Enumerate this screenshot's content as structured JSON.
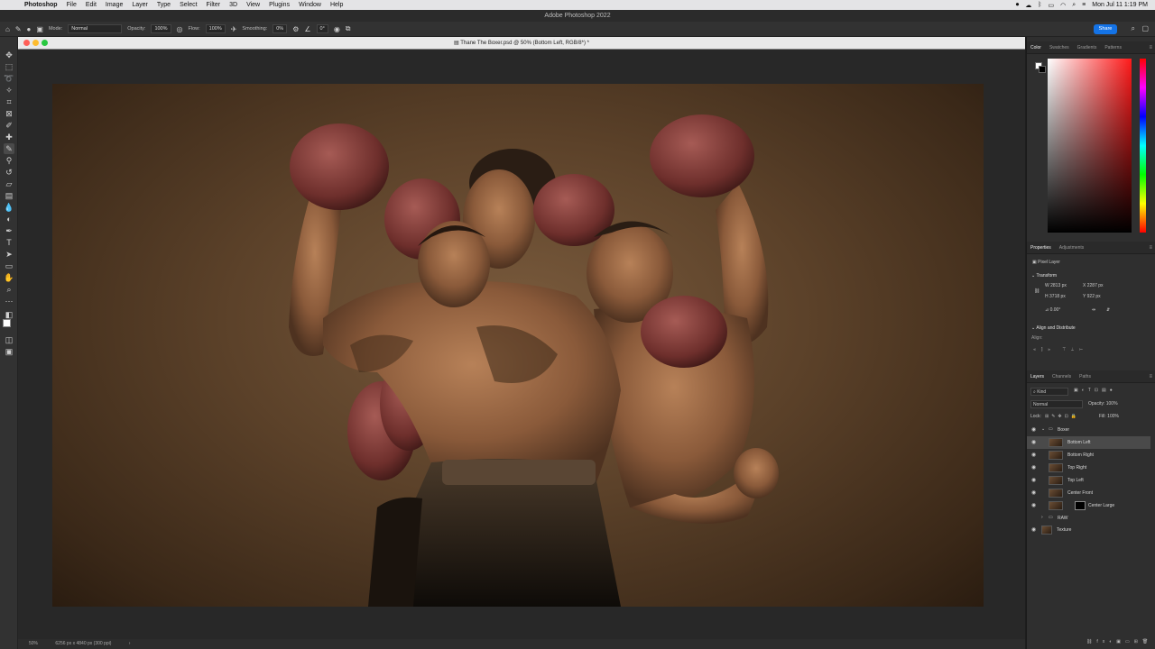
{
  "menubar": {
    "apple": "",
    "items": [
      "Photoshop",
      "File",
      "Edit",
      "Image",
      "Layer",
      "Type",
      "Select",
      "Filter",
      "3D",
      "View",
      "Plugins",
      "Window",
      "Help"
    ],
    "clock": "Mon Jul 11  1:19 PM"
  },
  "window": {
    "title": "Adobe Photoshop 2022"
  },
  "options": {
    "mode_label": "Mode:",
    "mode_value": "Normal",
    "opacity_label": "Opacity:",
    "opacity_value": "100%",
    "flow_label": "Flow:",
    "flow_value": "100%",
    "smoothing_label": "Smoothing:",
    "smoothing_value": "0%",
    "angle_value": "0°",
    "share_label": "Share"
  },
  "document": {
    "tab_title": "Thane The Boxer.psd @ 50% (Bottom Left, RGB/8*) *"
  },
  "statusbar": {
    "zoom": "50%",
    "info": "6256 px x 4840 px (300 ppi)",
    "arrow": "›"
  },
  "color_panel": {
    "tabs": [
      "Color",
      "Swatches",
      "Gradients",
      "Patterns"
    ],
    "hue_color": "#ff1a1a"
  },
  "properties_panel": {
    "tabs": [
      "Properties",
      "Adjustments"
    ],
    "kind": "Pixel Layer",
    "transform_title": "Transform",
    "w_label": "W",
    "w_value": "2813 px",
    "h_label": "H",
    "h_value": "3718 px",
    "x_label": "X",
    "x_value": "2287 px",
    "y_label": "Y",
    "y_value": "922 px",
    "angle_value": "0.00°",
    "align_title": "Align and Distribute",
    "align_label": "Align:"
  },
  "layers_panel": {
    "tabs": [
      "Layers",
      "Channels",
      "Paths"
    ],
    "filter_label": "Kind",
    "blend_mode": "Normal",
    "opacity_label": "Opacity:",
    "opacity_value": "100%",
    "lock_label": "Lock:",
    "fill_label": "Fill:",
    "fill_value": "100%",
    "layers": [
      {
        "name": "Boxer",
        "type": "group",
        "open": true
      },
      {
        "name": "Bottom Left",
        "type": "pixel",
        "selected": true
      },
      {
        "name": "Bottom Right",
        "type": "pixel"
      },
      {
        "name": "Top Right",
        "type": "pixel"
      },
      {
        "name": "Top Left",
        "type": "pixel"
      },
      {
        "name": "Center Front",
        "type": "pixel"
      },
      {
        "name": "Center Large",
        "type": "pixel-mask"
      },
      {
        "name": "RAW",
        "type": "group",
        "open": false
      },
      {
        "name": "Texture",
        "type": "pixel"
      }
    ]
  }
}
